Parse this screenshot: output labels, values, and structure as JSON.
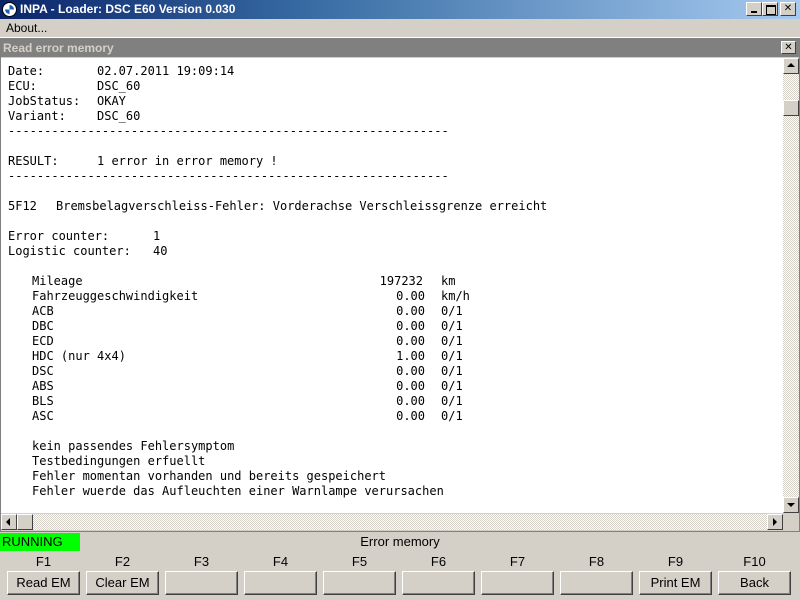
{
  "window": {
    "title": "INPA - Loader:  DSC E60 Version 0.030"
  },
  "menu": {
    "about": "About..."
  },
  "child_window": {
    "title": "Read error memory"
  },
  "report": {
    "date_label": "Date:",
    "date_value": "02.07.2011 19:09:14",
    "ecu_label": "ECU:",
    "ecu_value": "DSC_60",
    "jobstatus_label": "JobStatus:",
    "jobstatus_value": "OKAY",
    "variant_label": "Variant:",
    "variant_value": "DSC_60",
    "separator": "-------------------------------------------------------------",
    "result_label": "RESULT:",
    "result_value": "1 error in error memory !",
    "error_code": "5F12",
    "error_text": "Bremsbelagverschleiss-Fehler: Vorderachse Verschleissgrenze erreicht",
    "error_counter_label": "Error counter:",
    "error_counter_value": "1",
    "logistic_counter_label": "Logistic counter:",
    "logistic_counter_value": "40",
    "conditions": [
      {
        "name": "Mileage",
        "value": "197232",
        "unit": "km"
      },
      {
        "name": "Fahrzeuggeschwindigkeit",
        "value": "0.00",
        "unit": "km/h"
      },
      {
        "name": "ACB",
        "value": "0.00",
        "unit": "0/1"
      },
      {
        "name": "DBC",
        "value": "0.00",
        "unit": "0/1"
      },
      {
        "name": "ECD",
        "value": "0.00",
        "unit": "0/1"
      },
      {
        "name": "HDC (nur 4x4)",
        "value": "1.00",
        "unit": "0/1"
      },
      {
        "name": "DSC",
        "value": "0.00",
        "unit": "0/1"
      },
      {
        "name": "ABS",
        "value": "0.00",
        "unit": "0/1"
      },
      {
        "name": "BLS",
        "value": "0.00",
        "unit": "0/1"
      },
      {
        "name": "ASC",
        "value": "0.00",
        "unit": "0/1"
      }
    ],
    "notes": [
      "kein passendes Fehlersymptom",
      "Testbedingungen erfuellt",
      "Fehler momentan vorhanden und bereits gespeichert",
      "Fehler wuerde das Aufleuchten einer Warnlampe verursachen"
    ]
  },
  "status": {
    "state": "RUNNING",
    "state_color": "#00ff00",
    "screen_title": "Error memory"
  },
  "function_keys": [
    {
      "key": "F1",
      "label": "Read EM"
    },
    {
      "key": "F2",
      "label": "Clear EM"
    },
    {
      "key": "F3",
      "label": ""
    },
    {
      "key": "F4",
      "label": ""
    },
    {
      "key": "F5",
      "label": ""
    },
    {
      "key": "F6",
      "label": ""
    },
    {
      "key": "F7",
      "label": ""
    },
    {
      "key": "F8",
      "label": ""
    },
    {
      "key": "F9",
      "label": "Print EM"
    },
    {
      "key": "F10",
      "label": "Back"
    }
  ]
}
